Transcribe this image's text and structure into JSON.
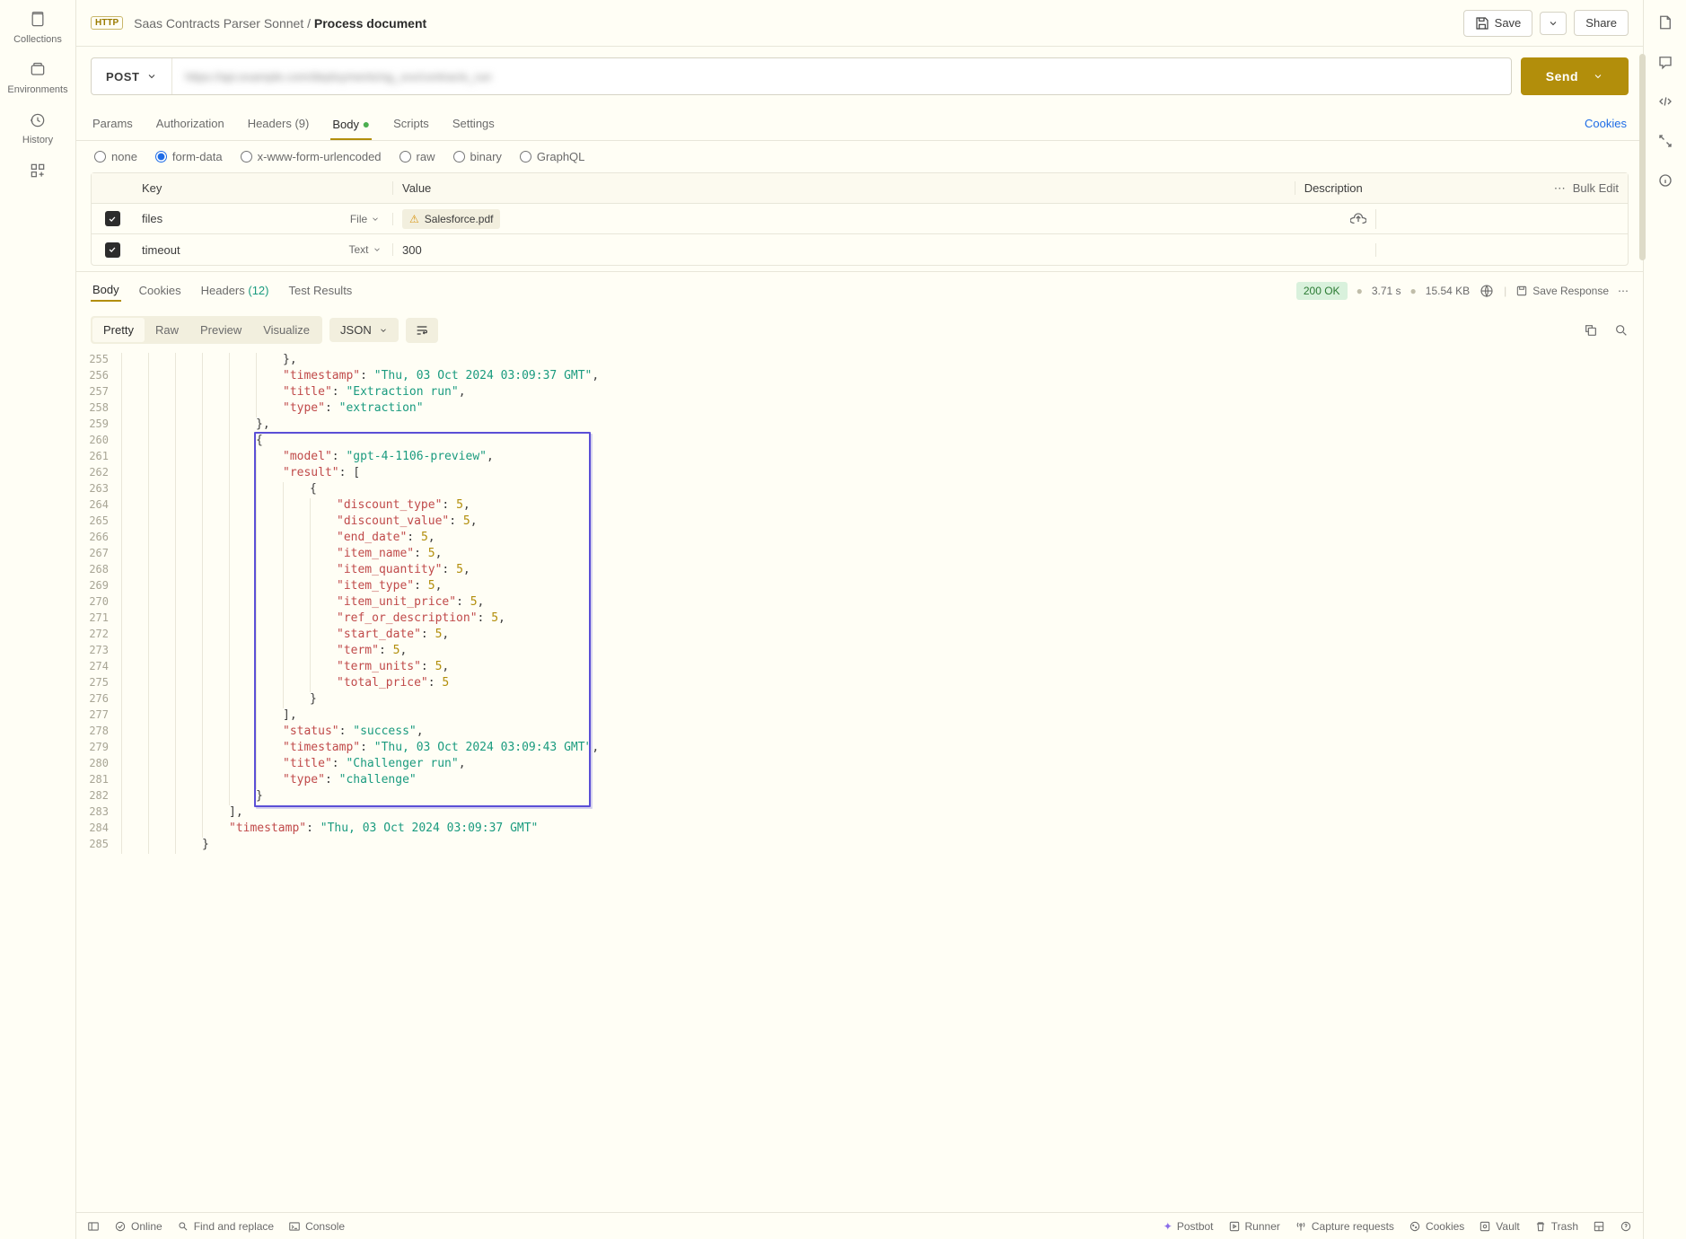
{
  "leftRail": {
    "collections": "Collections",
    "environments": "Environments",
    "history": "History"
  },
  "breadcrumb": {
    "parent": "Saas Contracts Parser Sonnet",
    "sep": "/",
    "current": "Process document"
  },
  "topbar": {
    "save": "Save",
    "share": "Share"
  },
  "method": "POST",
  "url": "https://api.example.com/deployments/sg_xxx/contracts_run",
  "send": "Send",
  "reqTabs": {
    "params": "Params",
    "authorization": "Authorization",
    "headers": "Headers",
    "headersCount": "(9)",
    "body": "Body",
    "scripts": "Scripts",
    "settings": "Settings",
    "cookies": "Cookies"
  },
  "bodyTypes": {
    "none": "none",
    "formData": "form-data",
    "urlencoded": "x-www-form-urlencoded",
    "raw": "raw",
    "binary": "binary",
    "graphql": "GraphQL"
  },
  "formHeaders": {
    "key": "Key",
    "value": "Value",
    "description": "Description",
    "bulkEdit": "Bulk Edit"
  },
  "formRows": [
    {
      "key": "files",
      "type": "File",
      "value": "Salesforce.pdf"
    },
    {
      "key": "timeout",
      "type": "Text",
      "value": "300"
    }
  ],
  "resTabs": {
    "body": "Body",
    "cookies": "Cookies",
    "headers": "Headers",
    "headersCount": "(12)",
    "testResults": "Test Results"
  },
  "resMeta": {
    "status": "200 OK",
    "time": "3.71 s",
    "size": "15.54 KB",
    "saveResponse": "Save Response"
  },
  "viewBtns": {
    "pretty": "Pretty",
    "raw": "Raw",
    "preview": "Preview",
    "visualize": "Visualize"
  },
  "format": "JSON",
  "codeLines": [
    {
      "n": 255,
      "ind": 6,
      "k": "",
      "hl": false,
      "txt": "},"
    },
    {
      "n": 256,
      "ind": 6,
      "k": "\"timestamp\"",
      "v": "\"Thu, 03 Oct 2024 03:09:37 GMT\"",
      "comma": true,
      "hl": false
    },
    {
      "n": 257,
      "ind": 6,
      "k": "\"title\"",
      "v": "\"Extraction run\"",
      "comma": true,
      "hl": false
    },
    {
      "n": 258,
      "ind": 6,
      "k": "\"type\"",
      "v": "\"extraction\"",
      "hl": false
    },
    {
      "n": 259,
      "ind": 5,
      "txt": "},",
      "hl": false
    },
    {
      "n": 260,
      "ind": 5,
      "txt": "{",
      "hl": true
    },
    {
      "n": 261,
      "ind": 6,
      "k": "\"model\"",
      "v": "\"gpt-4-1106-preview\"",
      "comma": true,
      "hl": true
    },
    {
      "n": 262,
      "ind": 6,
      "k": "\"result\"",
      "raw": "[",
      "hl": true
    },
    {
      "n": 263,
      "ind": 7,
      "txt": "{",
      "hl": true
    },
    {
      "n": 264,
      "ind": 8,
      "k": "\"discount_type\"",
      "num": "5",
      "comma": true,
      "hl": true
    },
    {
      "n": 265,
      "ind": 8,
      "k": "\"discount_value\"",
      "num": "5",
      "comma": true,
      "hl": true
    },
    {
      "n": 266,
      "ind": 8,
      "k": "\"end_date\"",
      "num": "5",
      "comma": true,
      "hl": true
    },
    {
      "n": 267,
      "ind": 8,
      "k": "\"item_name\"",
      "num": "5",
      "comma": true,
      "hl": true
    },
    {
      "n": 268,
      "ind": 8,
      "k": "\"item_quantity\"",
      "num": "5",
      "comma": true,
      "hl": true
    },
    {
      "n": 269,
      "ind": 8,
      "k": "\"item_type\"",
      "num": "5",
      "comma": true,
      "hl": true
    },
    {
      "n": 270,
      "ind": 8,
      "k": "\"item_unit_price\"",
      "num": "5",
      "comma": true,
      "hl": true
    },
    {
      "n": 271,
      "ind": 8,
      "k": "\"ref_or_description\"",
      "num": "5",
      "comma": true,
      "hl": true
    },
    {
      "n": 272,
      "ind": 8,
      "k": "\"start_date\"",
      "num": "5",
      "comma": true,
      "hl": true
    },
    {
      "n": 273,
      "ind": 8,
      "k": "\"term\"",
      "num": "5",
      "comma": true,
      "hl": true
    },
    {
      "n": 274,
      "ind": 8,
      "k": "\"term_units\"",
      "num": "5",
      "comma": true,
      "hl": true
    },
    {
      "n": 275,
      "ind": 8,
      "k": "\"total_price\"",
      "num": "5",
      "hl": true
    },
    {
      "n": 276,
      "ind": 7,
      "txt": "}",
      "hl": true
    },
    {
      "n": 277,
      "ind": 6,
      "txt": "],",
      "hl": true
    },
    {
      "n": 278,
      "ind": 6,
      "k": "\"status\"",
      "v": "\"success\"",
      "comma": true,
      "hl": true
    },
    {
      "n": 279,
      "ind": 6,
      "k": "\"timestamp\"",
      "v": "\"Thu, 03 Oct 2024 03:09:43 GMT\"",
      "comma": true,
      "hl": true
    },
    {
      "n": 280,
      "ind": 6,
      "k": "\"title\"",
      "v": "\"Challenger run\"",
      "comma": true,
      "hl": true
    },
    {
      "n": 281,
      "ind": 6,
      "k": "\"type\"",
      "v": "\"challenge\"",
      "hl": true
    },
    {
      "n": 282,
      "ind": 5,
      "txt": "}",
      "hl": true
    },
    {
      "n": 283,
      "ind": 4,
      "txt": "],",
      "hl": false
    },
    {
      "n": 284,
      "ind": 4,
      "k": "\"timestamp\"",
      "v": "\"Thu, 03 Oct 2024 03:09:37 GMT\"",
      "hl": false
    },
    {
      "n": 285,
      "ind": 3,
      "txt": "}",
      "hl": false
    }
  ],
  "footer": {
    "online": "Online",
    "findReplace": "Find and replace",
    "console": "Console",
    "postbot": "Postbot",
    "runner": "Runner",
    "capture": "Capture requests",
    "cookies": "Cookies",
    "vault": "Vault",
    "trash": "Trash"
  }
}
